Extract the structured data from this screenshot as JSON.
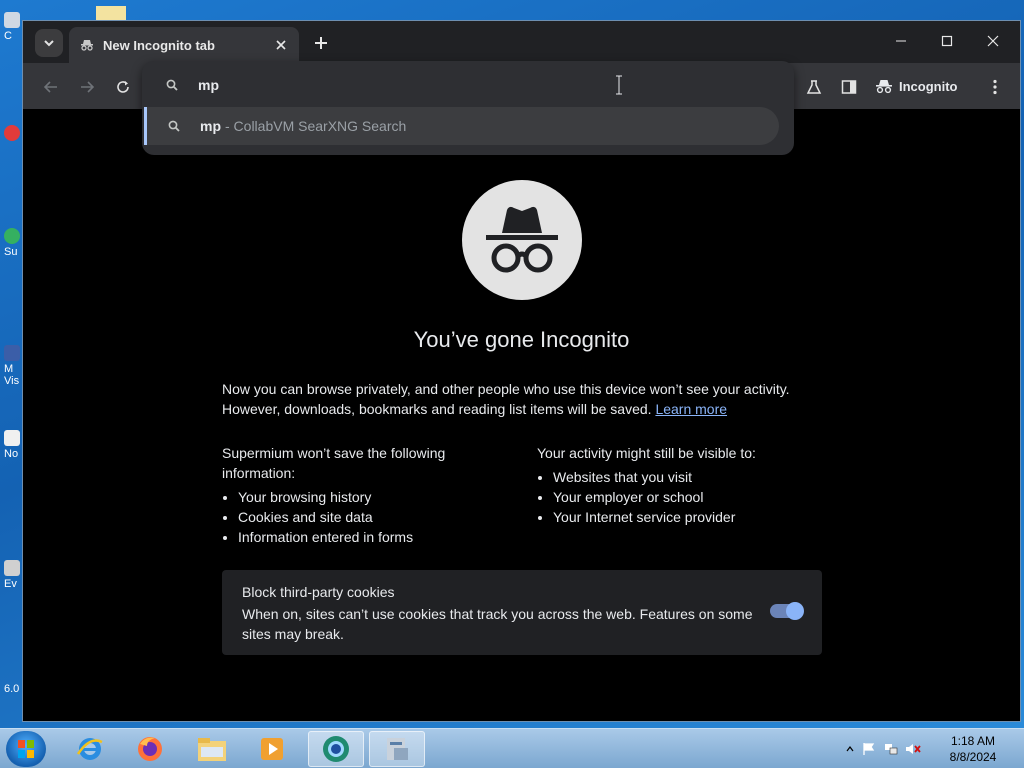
{
  "desktop": {
    "icons": [
      {
        "label": "C"
      },
      {
        "label": "Su"
      },
      {
        "label": "M Vis"
      },
      {
        "label": "No"
      },
      {
        "label": "Ev"
      },
      {
        "label": "6.0"
      }
    ]
  },
  "browser": {
    "tab": {
      "title": "New Incognito tab"
    },
    "toolbar": {
      "incognito_label": "Incognito"
    },
    "omnibox": {
      "typed_text": "mp",
      "suggestion_query": "mp",
      "suggestion_source": "- CollabVM SearXNG Search"
    }
  },
  "incognito_page": {
    "heading": "You’ve gone Incognito",
    "intro_line1": "Now you can browse privately, and other people who use this device won’t see your activity.",
    "intro_line2": "However, downloads, bookmarks and reading list items will be saved.",
    "learn_more": "Learn more",
    "left_heading": "Supermium won’t save the following information:",
    "left_items": [
      "Your browsing history",
      "Cookies and site data",
      "Information entered in forms"
    ],
    "right_heading": "Your activity might still be visible to:",
    "right_items": [
      "Websites that you visit",
      "Your employer or school",
      "Your Internet service provider"
    ],
    "cookie_card": {
      "title": "Block third-party cookies",
      "description": "When on, sites can’t use cookies that track you across the web. Features on some sites may break.",
      "toggle_on": true
    }
  },
  "taskbar": {
    "time": "1:18 AM",
    "date": "8/8/2024"
  },
  "colors": {
    "accent_link": "#8ab4f8",
    "toggle": "#8ab4f8",
    "page_bg": "#000000",
    "toolbar_bg": "#35363a"
  }
}
